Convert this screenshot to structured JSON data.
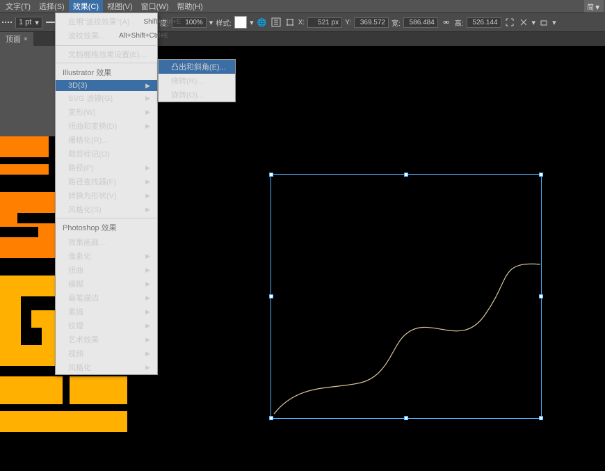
{
  "menubar": {
    "items": [
      {
        "label": "文字(T)"
      },
      {
        "label": "选择(S)"
      },
      {
        "label": "效果(C)"
      },
      {
        "label": "视图(V)"
      },
      {
        "label": "窗口(W)"
      },
      {
        "label": "帮助(H)"
      }
    ],
    "lang_toggle": "简▼"
  },
  "toolbar": {
    "stroke_pt": "1 pt",
    "opacity_label": "度:",
    "opacity": "100%",
    "style_label": "样式:",
    "x_label": "X:",
    "x": "521 px",
    "y_label": "Y:",
    "y": "369.572",
    "w_label": "宽:",
    "w": "586.484",
    "link_icon": "⚮",
    "h_label": "高:",
    "h": "526.144"
  },
  "doc_tab": {
    "title": "顶面",
    "close": "×"
  },
  "effects_menu": {
    "top": [
      {
        "label": "应用\"波纹效果\"(A)",
        "shortcut": "Shift+Ctrl+E"
      },
      {
        "label": "波纹效果...",
        "shortcut": "Alt+Shift+Ctrl+E"
      }
    ],
    "doc_settings": "文档栅格效果设置(E)...",
    "illustrator_header": "Illustrator 效果",
    "illustrator": [
      {
        "label": "3D(3)",
        "has_sub": true,
        "hi": true
      },
      {
        "label": "SVG 滤镜(G)",
        "has_sub": true
      },
      {
        "label": "变形(W)",
        "has_sub": true
      },
      {
        "label": "扭曲和变换(D)",
        "has_sub": true
      },
      {
        "label": "栅格化(R)..."
      },
      {
        "label": "裁剪标记(O)"
      },
      {
        "label": "路径(P)",
        "has_sub": true
      },
      {
        "label": "路径查找器(F)",
        "has_sub": true
      },
      {
        "label": "转换为形状(V)",
        "has_sub": true
      },
      {
        "label": "风格化(S)",
        "has_sub": true
      }
    ],
    "photoshop_header": "Photoshop 效果",
    "photoshop": [
      {
        "label": "效果画廊..."
      },
      {
        "label": "像素化",
        "has_sub": true
      },
      {
        "label": "扭曲",
        "has_sub": true
      },
      {
        "label": "模糊",
        "has_sub": true
      },
      {
        "label": "画笔描边",
        "has_sub": true
      },
      {
        "label": "素描",
        "has_sub": true
      },
      {
        "label": "纹理",
        "has_sub": true
      },
      {
        "label": "艺术效果",
        "has_sub": true
      },
      {
        "label": "视频",
        "has_sub": true
      },
      {
        "label": "风格化",
        "has_sub": true
      }
    ]
  },
  "sub_3d": [
    {
      "label": "凸出和斜角(E)...",
      "hi": true
    },
    {
      "label": "绕转(R)..."
    },
    {
      "label": "旋转(O)..."
    }
  ]
}
